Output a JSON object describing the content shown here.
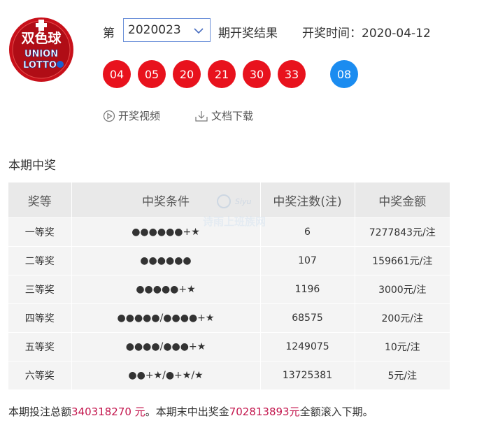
{
  "logo": {
    "text": "双色球",
    "union": "UNION",
    "lotto": "LOTTO"
  },
  "header": {
    "issue_prefix": "第",
    "issue_value": "2020023",
    "result_label": "期开奖结果",
    "draw_time": "开奖时间：2020-04-12"
  },
  "balls": {
    "red": [
      "04",
      "05",
      "20",
      "21",
      "30",
      "33"
    ],
    "blue": "08",
    "colors": {
      "red": "#e8121d",
      "blue": "#1b8cf0"
    }
  },
  "links": {
    "video": "开奖视频",
    "download": "文档下载"
  },
  "section_title": "本期中奖",
  "table": {
    "headers": [
      "奖等",
      "中奖条件",
      "中奖注数(注)",
      "中奖金额"
    ],
    "rows": [
      [
        "一等奖",
        "●●●●●●+★",
        "6",
        "7277843元/注"
      ],
      [
        "二等奖",
        "●●●●●●",
        "107",
        "159661元/注"
      ],
      [
        "三等奖",
        "●●●●●+★",
        "1196",
        "3000元/注"
      ],
      [
        "四等奖",
        "●●●●●/●●●●+★",
        "68575",
        "200元/注"
      ],
      [
        "五等奖",
        "●●●●/●●●+★",
        "1249075",
        "10元/注"
      ],
      [
        "六等奖",
        "●●+★/●+★/★",
        "13725381",
        "5元/注"
      ]
    ]
  },
  "watermark": {
    "brand": "Siyu",
    "text": "诗雨上班族网"
  },
  "footer": {
    "prefix": "本期投注总额",
    "total": "340318270 元",
    "middle": "。本期末中出奖金",
    "pool": "702813893元",
    "suffix": "全额滚入下期。",
    "highlight_color": "#c3164d"
  }
}
